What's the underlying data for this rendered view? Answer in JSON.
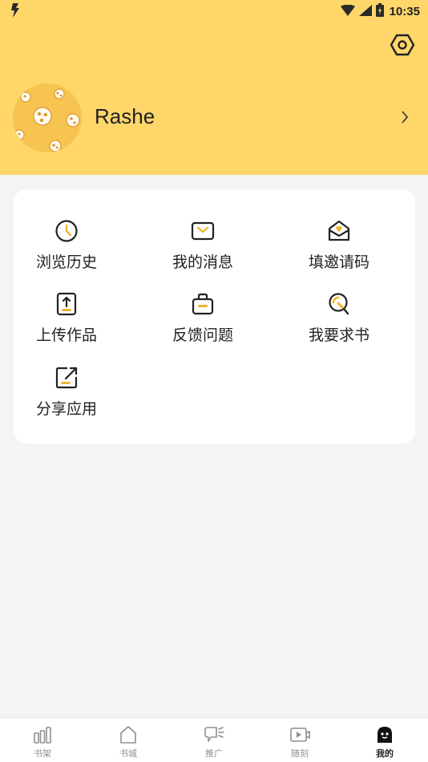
{
  "status_bar": {
    "time": "10:35"
  },
  "profile": {
    "username": "Rashe"
  },
  "menu": {
    "items": [
      {
        "label": "浏览历史",
        "icon": "clock-icon"
      },
      {
        "label": "我的消息",
        "icon": "mail-icon"
      },
      {
        "label": "填邀请码",
        "icon": "invite-envelope-icon"
      },
      {
        "label": "上传作品",
        "icon": "upload-icon"
      },
      {
        "label": "反馈问题",
        "icon": "feedback-briefcase-icon"
      },
      {
        "label": "我要求书",
        "icon": "search-book-icon"
      },
      {
        "label": "分享应用",
        "icon": "share-icon"
      }
    ]
  },
  "tabbar": {
    "items": [
      {
        "label": "书架",
        "icon": "bookshelf-icon"
      },
      {
        "label": "书城",
        "icon": "bookstore-icon"
      },
      {
        "label": "推广",
        "icon": "promote-icon"
      },
      {
        "label": "随刻",
        "icon": "video-icon"
      },
      {
        "label": "我的",
        "icon": "profile-icon"
      }
    ],
    "active": "我的"
  },
  "colors": {
    "header_bg": "#fed66a",
    "accent": "#f7c451",
    "page_bg": "#f4f4f4"
  }
}
